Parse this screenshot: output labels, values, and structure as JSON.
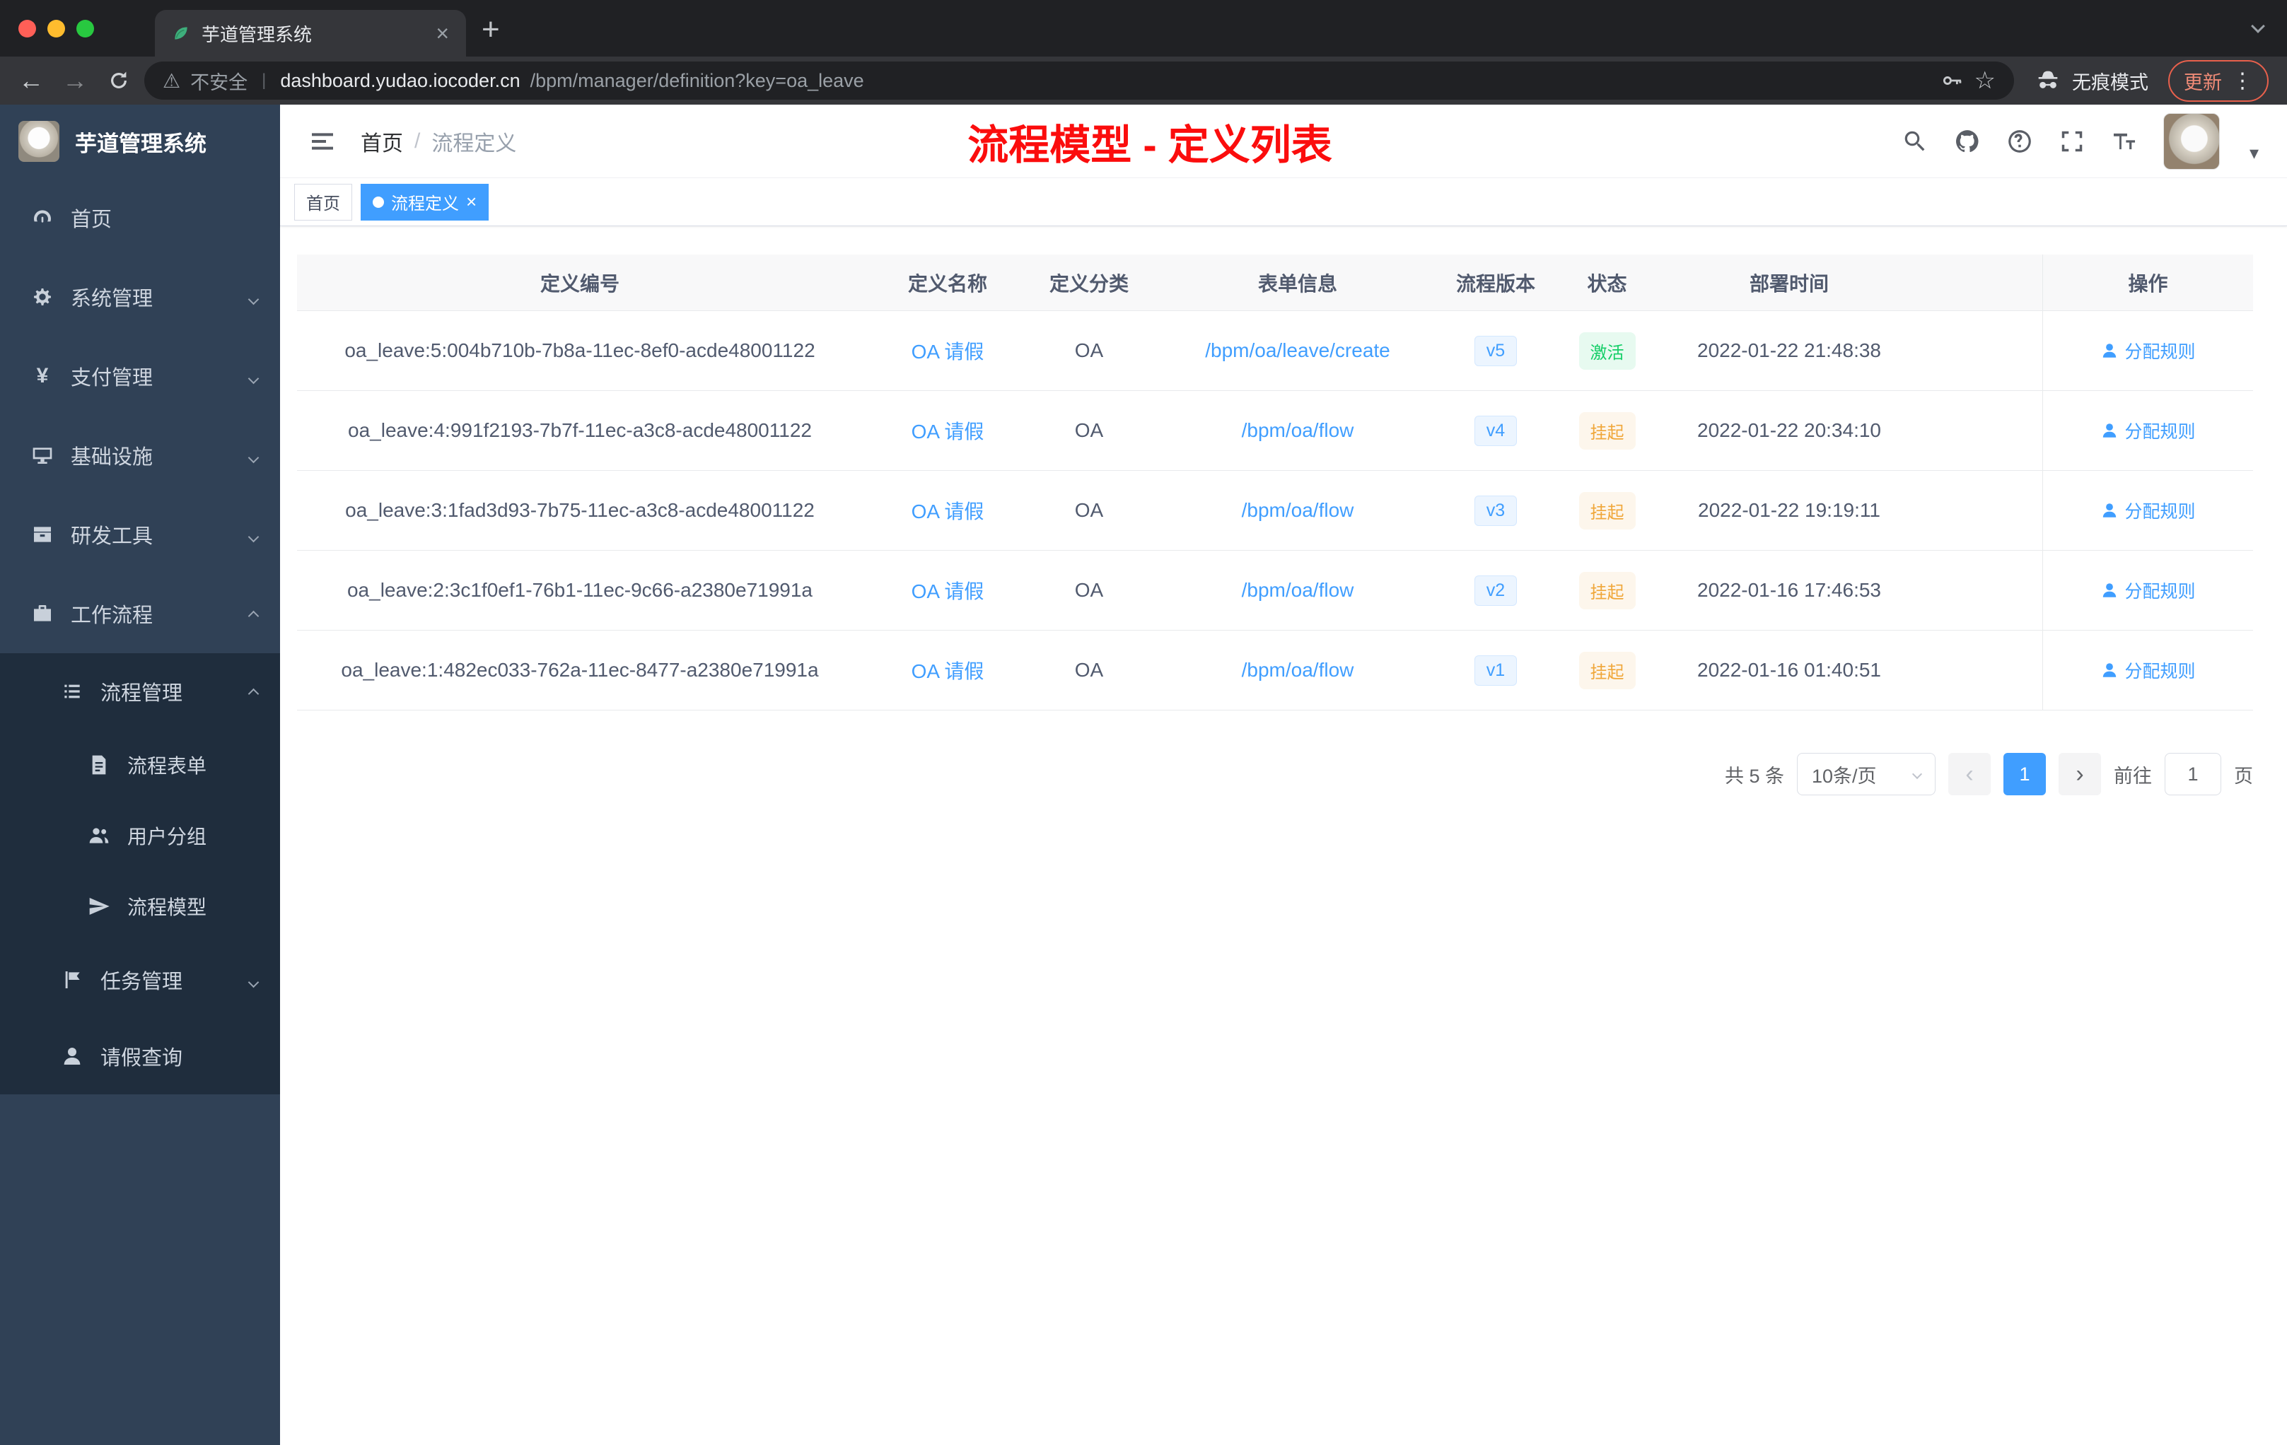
{
  "browser": {
    "tab_title": "芋道管理系统",
    "security_label": "不安全",
    "url_host": "dashboard.yudao.iocoder.cn",
    "url_path": "/bpm/manager/definition?key=oa_leave",
    "incognito_label": "无痕模式",
    "update_label": "更新"
  },
  "glyphs": {
    "back": "←",
    "forward": "→",
    "warning": "⚠",
    "star": "☆",
    "dots": "⋮",
    "close": "×",
    "plus": "+",
    "divider": "|",
    "prev": "‹",
    "next": "›",
    "caret": "▾",
    "yen": "¥"
  },
  "sidebar": {
    "logo_title": "芋道管理系统",
    "items": [
      {
        "label": "首页"
      },
      {
        "label": "系统管理"
      },
      {
        "label": "支付管理"
      },
      {
        "label": "基础设施"
      },
      {
        "label": "研发工具"
      },
      {
        "label": "工作流程"
      },
      {
        "label": "流程管理"
      },
      {
        "label": "流程表单"
      },
      {
        "label": "用户分组"
      },
      {
        "label": "流程模型"
      },
      {
        "label": "任务管理"
      },
      {
        "label": "请假查询"
      }
    ]
  },
  "header": {
    "breadcrumb_home": "首页",
    "breadcrumb_sep": "/",
    "breadcrumb_current": "流程定义",
    "annotation": "流程模型 - 定义列表"
  },
  "tags": {
    "home": "首页",
    "active": "流程定义"
  },
  "table": {
    "columns": [
      "定义编号",
      "定义名称",
      "定义分类",
      "表单信息",
      "流程版本",
      "状态",
      "部署时间",
      "操作"
    ],
    "rows": [
      {
        "id": "oa_leave:5:004b710b-7b8a-11ec-8ef0-acde48001122",
        "name": "OA 请假",
        "category": "OA",
        "form": "/bpm/oa/leave/create",
        "version": "v5",
        "status": "激活",
        "time": "2022-01-22 21:48:38",
        "action": "分配规则"
      },
      {
        "id": "oa_leave:4:991f2193-7b7f-11ec-a3c8-acde48001122",
        "name": "OA 请假",
        "category": "OA",
        "form": "/bpm/oa/flow",
        "version": "v4",
        "status": "挂起",
        "time": "2022-01-22 20:34:10",
        "action": "分配规则"
      },
      {
        "id": "oa_leave:3:1fad3d93-7b75-11ec-a3c8-acde48001122",
        "name": "OA 请假",
        "category": "OA",
        "form": "/bpm/oa/flow",
        "version": "v3",
        "status": "挂起",
        "time": "2022-01-22 19:19:11",
        "action": "分配规则"
      },
      {
        "id": "oa_leave:2:3c1f0ef1-76b1-11ec-9c66-a2380e71991a",
        "name": "OA 请假",
        "category": "OA",
        "form": "/bpm/oa/flow",
        "version": "v2",
        "status": "挂起",
        "time": "2022-01-16 17:46:53",
        "action": "分配规则"
      },
      {
        "id": "oa_leave:1:482ec033-762a-11ec-8477-a2380e71991a",
        "name": "OA 请假",
        "category": "OA",
        "form": "/bpm/oa/flow",
        "version": "v1",
        "status": "挂起",
        "time": "2022-01-16 01:40:51",
        "action": "分配规则"
      }
    ]
  },
  "pagination": {
    "total": "共 5 条",
    "page_size": "10条/页",
    "page": "1",
    "goto_label": "前往",
    "goto_value": "1",
    "goto_unit": "页"
  },
  "colors": {
    "accent": "#409eff",
    "annotation_red": "#fb0d0d",
    "status_active_text": "#13ce66",
    "status_active_bg": "#e7faf0",
    "status_suspended_text": "#f0a73a",
    "status_suspended_bg": "#fdf6ec",
    "sidebar_bg": "#304156",
    "submenu_bg": "#1f2d3d"
  }
}
